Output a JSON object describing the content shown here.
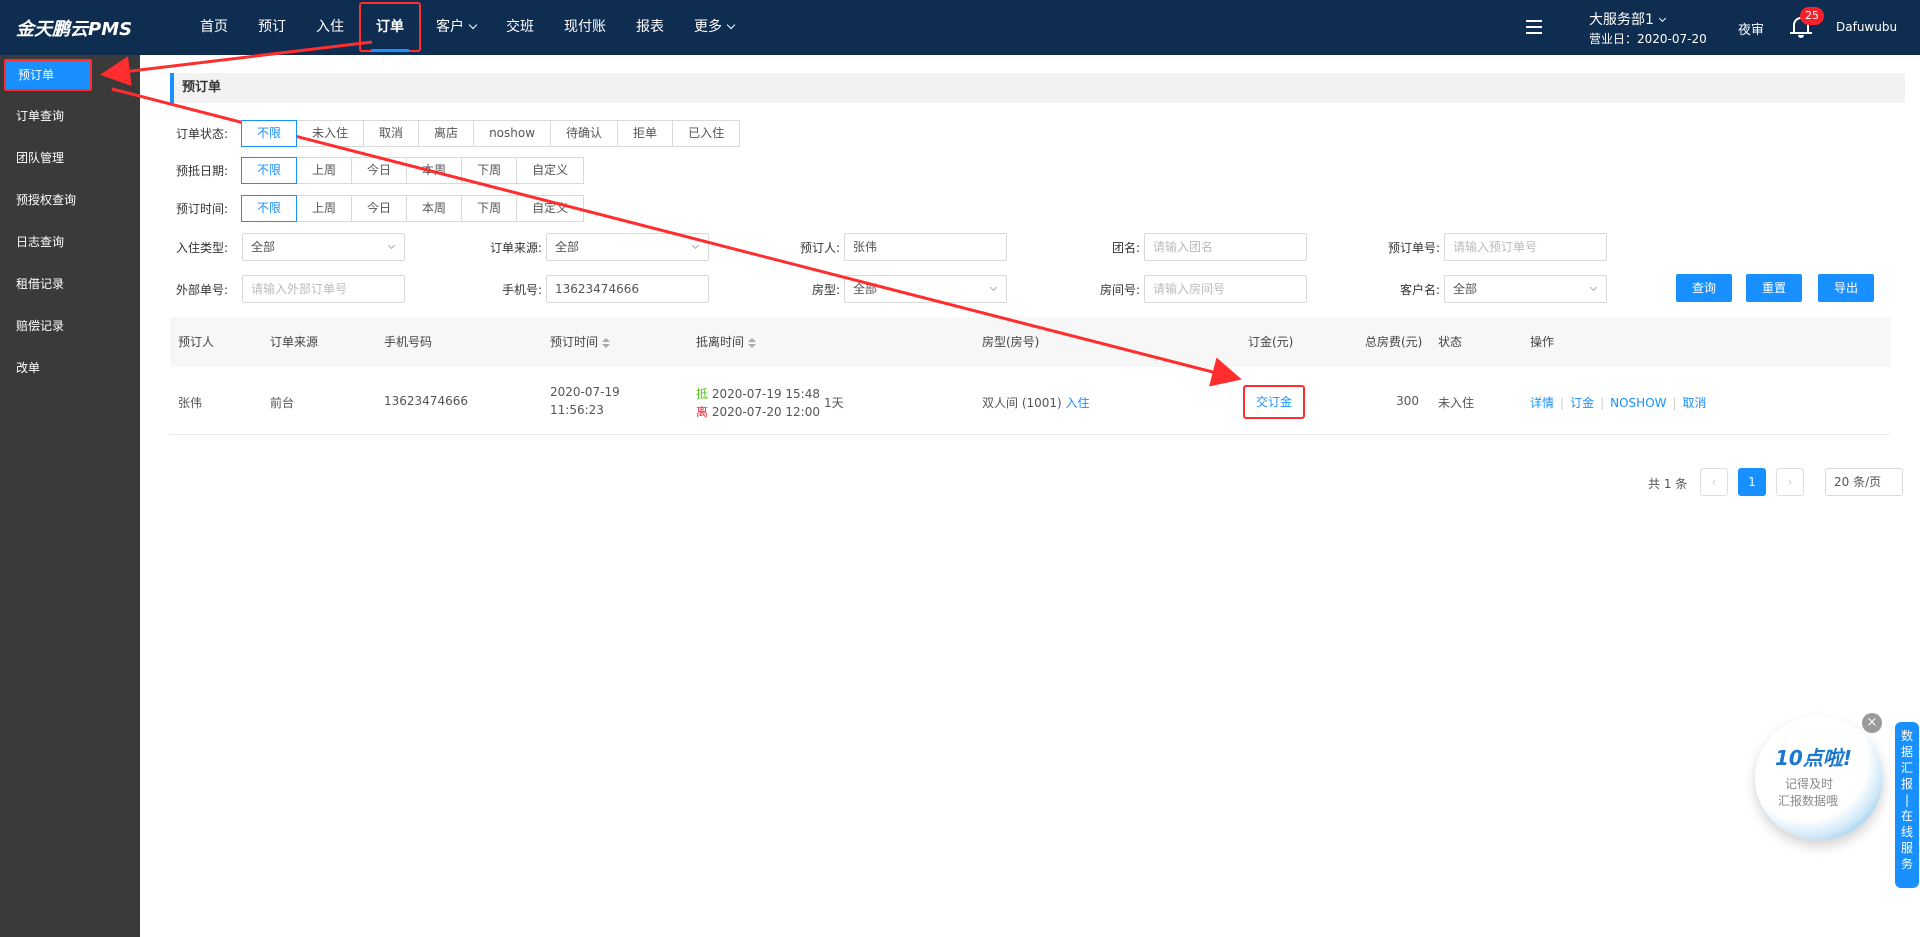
{
  "brand": "金天鹏云PMS",
  "nav": [
    "首页",
    "预订",
    "入住",
    "订单",
    "客户",
    "交班",
    "现付账",
    "报表",
    "更多"
  ],
  "header_right": {
    "dept": "大服务部1",
    "biz_date": "营业日：2020-07-20",
    "night_audit": "夜审",
    "badge_count": "25",
    "user": "Dafuwubu"
  },
  "sidebar": [
    "预订单",
    "订单查询",
    "团队管理",
    "预授权查询",
    "日志查询",
    "租借记录",
    "赔偿记录",
    "改单"
  ],
  "page_title": "预订单",
  "filters": {
    "status": {
      "label": "订单状态:",
      "options": [
        "不限",
        "未入住",
        "取消",
        "离店",
        "noshow",
        "待确认",
        "拒单",
        "已入住"
      ]
    },
    "arrival": {
      "label": "预抵日期:",
      "options": [
        "不限",
        "上周",
        "今日",
        "本周",
        "下周",
        "自定义"
      ]
    },
    "booked": {
      "label": "预订时间:",
      "options": [
        "不限",
        "上周",
        "今日",
        "本周",
        "下周",
        "自定义"
      ]
    }
  },
  "fields": {
    "checkin_type": {
      "label": "入住类型:",
      "value": "全部"
    },
    "order_source": {
      "label": "订单来源:",
      "value": "全部"
    },
    "booker": {
      "label": "预订人:",
      "value": "张伟"
    },
    "group": {
      "label": "团名:",
      "placeholder": "请输入团名"
    },
    "order_no": {
      "label": "预订单号:",
      "placeholder": "请输入预订单号"
    },
    "ext_no": {
      "label": "外部单号:",
      "placeholder": "请输入外部订单号"
    },
    "phone": {
      "label": "手机号:",
      "value": "13623474666"
    },
    "room_type": {
      "label": "房型:",
      "value": "全部"
    },
    "room_no": {
      "label": "房间号:",
      "placeholder": "请输入房间号"
    },
    "customer": {
      "label": "客户名:",
      "value": "全部"
    }
  },
  "buttons": {
    "query": "查询",
    "reset": "重置",
    "export": "导出"
  },
  "table": {
    "headers": [
      "预订人",
      "订单来源",
      "手机号码",
      "预订时间",
      "抵离时间",
      "房型(房号)",
      "订金(元)",
      "总房费(元)",
      "状态",
      "操作"
    ],
    "row": {
      "booker": "张伟",
      "source": "前台",
      "phone": "13623474666",
      "book_date": "2020-07-19",
      "book_time": "11:56:23",
      "arrive_tag": "抵",
      "arrive": "2020-07-19 15:48",
      "depart_tag": "离",
      "depart": "2020-07-20 12:00",
      "nights": "1天",
      "room": "双人间 (1001)",
      "checkin_link": "入住",
      "deposit": "交订金",
      "total": "300",
      "status": "未入住",
      "actions": [
        "详情",
        "订金",
        "NOSHOW",
        "取消"
      ]
    }
  },
  "pagination": {
    "total": "共 1 条",
    "prev": "‹",
    "current": "1",
    "next": "›",
    "size": "20 条/页"
  },
  "floating": {
    "title": "10点啦!",
    "line1": "记得及时",
    "line2": "汇报数据哦",
    "close": "×",
    "side_tab": [
      "数",
      "据",
      "汇",
      "报",
      "|",
      "在",
      "线",
      "服",
      "务"
    ]
  },
  "colors": {
    "topbar": "#0f2d51",
    "sidebar": "#3a3a3a",
    "accent": "#1890ff",
    "annotation": "#ff2d2d"
  }
}
